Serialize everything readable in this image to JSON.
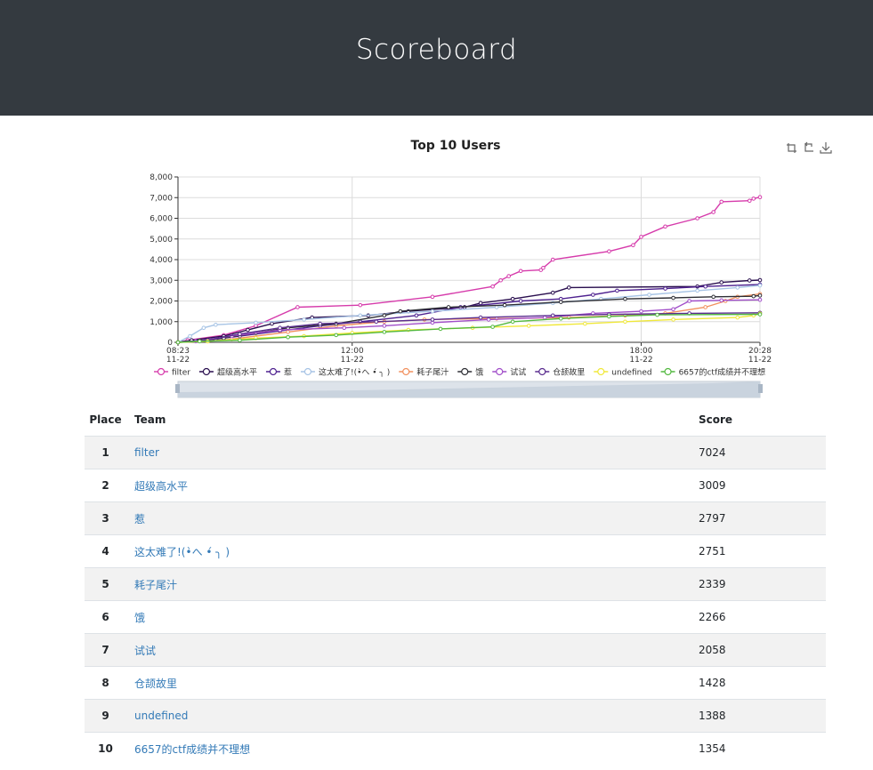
{
  "page": {
    "title": "Scoreboard"
  },
  "chart_data": {
    "type": "line",
    "title": "Top 10 Users",
    "toolbox": [
      "restore-icon",
      "refresh-icon",
      "download-icon"
    ],
    "ylim": [
      0,
      8000
    ],
    "y_ticks": [
      "0",
      "1,000",
      "2,000",
      "3,000",
      "4,000",
      "5,000",
      "6,000",
      "7,000",
      "8,000"
    ],
    "x_range": [
      "08:23",
      "20:28"
    ],
    "x_ticks": [
      {
        "time": "08:23",
        "date": "11-22"
      },
      {
        "time": "12:00",
        "date": "11-22"
      },
      {
        "time": "18:00",
        "date": "11-22"
      },
      {
        "time": "20:28",
        "date": "11-22"
      }
    ],
    "grid": true,
    "legend_position": "bottom",
    "series": [
      {
        "name": "filter",
        "color": "#d63bab",
        "points": [
          [
            "08:23",
            0
          ],
          [
            "08:35",
            100
          ],
          [
            "09:20",
            350
          ],
          [
            "10:00",
            800
          ],
          [
            "10:52",
            1700
          ],
          [
            "12:10",
            1800
          ],
          [
            "13:40",
            2200
          ],
          [
            "14:55",
            2700
          ],
          [
            "15:05",
            3000
          ],
          [
            "15:15",
            3200
          ],
          [
            "15:30",
            3450
          ],
          [
            "15:55",
            3500
          ],
          [
            "15:58",
            3600
          ],
          [
            "16:10",
            4000
          ],
          [
            "17:20",
            4400
          ],
          [
            "17:50",
            4700
          ],
          [
            "18:00",
            5100
          ],
          [
            "18:30",
            5600
          ],
          [
            "19:10",
            6000
          ],
          [
            "19:30",
            6300
          ],
          [
            "19:40",
            6800
          ],
          [
            "20:15",
            6850
          ],
          [
            "20:20",
            6950
          ],
          [
            "20:28",
            7024
          ]
        ]
      },
      {
        "name": "超级高水平",
        "color": "#2a0f4f",
        "points": [
          [
            "08:23",
            0
          ],
          [
            "08:40",
            100
          ],
          [
            "09:20",
            300
          ],
          [
            "09:50",
            600
          ],
          [
            "10:20",
            900
          ],
          [
            "11:10",
            1200
          ],
          [
            "12:20",
            1300
          ],
          [
            "13:10",
            1500
          ],
          [
            "14:20",
            1700
          ],
          [
            "14:40",
            1900
          ],
          [
            "15:20",
            2100
          ],
          [
            "16:10",
            2400
          ],
          [
            "16:30",
            2650
          ],
          [
            "19:10",
            2700
          ],
          [
            "19:40",
            2900
          ],
          [
            "20:15",
            2990
          ],
          [
            "20:28",
            3009
          ]
        ]
      },
      {
        "name": "惹",
        "color": "#4f2290",
        "points": [
          [
            "08:23",
            0
          ],
          [
            "09:10",
            150
          ],
          [
            "09:40",
            300
          ],
          [
            "10:30",
            550
          ],
          [
            "11:20",
            800
          ],
          [
            "12:10",
            1000
          ],
          [
            "13:20",
            1300
          ],
          [
            "14:15",
            1700
          ],
          [
            "15:30",
            2000
          ],
          [
            "16:20",
            2100
          ],
          [
            "17:00",
            2300
          ],
          [
            "17:30",
            2500
          ],
          [
            "18:30",
            2600
          ],
          [
            "19:20",
            2700
          ],
          [
            "20:28",
            2797
          ]
        ]
      },
      {
        "name": "这太难了!(•̀へ •́ ╮ )",
        "color": "#a7c4e5",
        "points": [
          [
            "08:23",
            0
          ],
          [
            "08:38",
            300
          ],
          [
            "08:55",
            700
          ],
          [
            "09:10",
            850
          ],
          [
            "10:00",
            950
          ],
          [
            "11:00",
            1100
          ],
          [
            "12:10",
            1300
          ],
          [
            "13:40",
            1500
          ],
          [
            "15:00",
            1700
          ],
          [
            "16:10",
            1900
          ],
          [
            "17:10",
            2100
          ],
          [
            "18:10",
            2300
          ],
          [
            "19:10",
            2500
          ],
          [
            "20:00",
            2650
          ],
          [
            "20:28",
            2751
          ]
        ]
      },
      {
        "name": "耗子尾汁",
        "color": "#f2915f",
        "points": [
          [
            "08:23",
            0
          ],
          [
            "09:00",
            50
          ],
          [
            "09:30",
            150
          ],
          [
            "10:40",
            500
          ],
          [
            "11:40",
            800
          ],
          [
            "12:40",
            1000
          ],
          [
            "13:30",
            1100
          ],
          [
            "15:00",
            1150
          ],
          [
            "16:30",
            1200
          ],
          [
            "17:40",
            1300
          ],
          [
            "18:30",
            1400
          ],
          [
            "19:20",
            1700
          ],
          [
            "19:45",
            2000
          ],
          [
            "20:00",
            2200
          ],
          [
            "20:28",
            2339
          ]
        ]
      },
      {
        "name": "饿",
        "color": "#2e2f35",
        "points": [
          [
            "08:23",
            0
          ],
          [
            "08:50",
            80
          ],
          [
            "09:20",
            200
          ],
          [
            "10:00",
            450
          ],
          [
            "10:40",
            700
          ],
          [
            "11:40",
            900
          ],
          [
            "12:40",
            1300
          ],
          [
            "13:00",
            1500
          ],
          [
            "14:00",
            1700
          ],
          [
            "15:10",
            1800
          ],
          [
            "16:20",
            1950
          ],
          [
            "17:40",
            2100
          ],
          [
            "18:40",
            2150
          ],
          [
            "19:30",
            2200
          ],
          [
            "20:20",
            2230
          ],
          [
            "20:28",
            2266
          ]
        ]
      },
      {
        "name": "试试",
        "color": "#a14ec9",
        "points": [
          [
            "08:23",
            0
          ],
          [
            "08:45",
            50
          ],
          [
            "09:30",
            300
          ],
          [
            "10:30",
            600
          ],
          [
            "11:50",
            700
          ],
          [
            "12:40",
            800
          ],
          [
            "13:40",
            950
          ],
          [
            "14:50",
            1100
          ],
          [
            "16:00",
            1200
          ],
          [
            "17:00",
            1400
          ],
          [
            "18:00",
            1500
          ],
          [
            "18:40",
            1600
          ],
          [
            "19:00",
            2000
          ],
          [
            "19:40",
            2030
          ],
          [
            "20:28",
            2058
          ]
        ]
      },
      {
        "name": "仓颉故里",
        "color": "#5a2d8f",
        "points": [
          [
            "08:23",
            0
          ],
          [
            "09:00",
            100
          ],
          [
            "09:40",
            400
          ],
          [
            "10:30",
            700
          ],
          [
            "11:20",
            900
          ],
          [
            "12:30",
            1000
          ],
          [
            "13:40",
            1100
          ],
          [
            "14:40",
            1200
          ],
          [
            "16:10",
            1300
          ],
          [
            "17:20",
            1350
          ],
          [
            "19:00",
            1400
          ],
          [
            "20:28",
            1428
          ]
        ]
      },
      {
        "name": "undefined",
        "color": "#f0e83a",
        "points": [
          [
            "08:23",
            0
          ],
          [
            "09:00",
            50
          ],
          [
            "10:00",
            200
          ],
          [
            "11:00",
            300
          ],
          [
            "12:00",
            450
          ],
          [
            "13:10",
            600
          ],
          [
            "14:30",
            700
          ],
          [
            "15:40",
            800
          ],
          [
            "16:50",
            900
          ],
          [
            "17:40",
            1000
          ],
          [
            "18:40",
            1100
          ],
          [
            "20:00",
            1200
          ],
          [
            "20:20",
            1300
          ],
          [
            "20:28",
            1388
          ]
        ]
      },
      {
        "name": "6657的ctf成绩并不理想",
        "color": "#53b940",
        "points": [
          [
            "08:23",
            0
          ],
          [
            "08:50",
            50
          ],
          [
            "09:40",
            100
          ],
          [
            "10:40",
            250
          ],
          [
            "11:40",
            350
          ],
          [
            "12:40",
            500
          ],
          [
            "13:50",
            650
          ],
          [
            "14:55",
            750
          ],
          [
            "15:20",
            1000
          ],
          [
            "16:20",
            1150
          ],
          [
            "17:20",
            1250
          ],
          [
            "18:20",
            1330
          ],
          [
            "20:28",
            1354
          ]
        ]
      }
    ]
  },
  "table": {
    "headers": {
      "place": "Place",
      "team": "Team",
      "score": "Score"
    },
    "rows": [
      {
        "place": "1",
        "team": "filter",
        "score": "7024"
      },
      {
        "place": "2",
        "team": "超级高水平",
        "score": "3009"
      },
      {
        "place": "3",
        "team": "惹",
        "score": "2797"
      },
      {
        "place": "4",
        "team": "这太难了!(•̀へ •́ ╮ )",
        "score": "2751"
      },
      {
        "place": "5",
        "team": "耗子尾汁",
        "score": "2339"
      },
      {
        "place": "6",
        "team": "饿",
        "score": "2266"
      },
      {
        "place": "7",
        "team": "试试",
        "score": "2058"
      },
      {
        "place": "8",
        "team": "仓颉故里",
        "score": "1428"
      },
      {
        "place": "9",
        "team": "undefined",
        "score": "1388"
      },
      {
        "place": "10",
        "team": "6657的ctf成绩并不理想",
        "score": "1354"
      }
    ]
  }
}
